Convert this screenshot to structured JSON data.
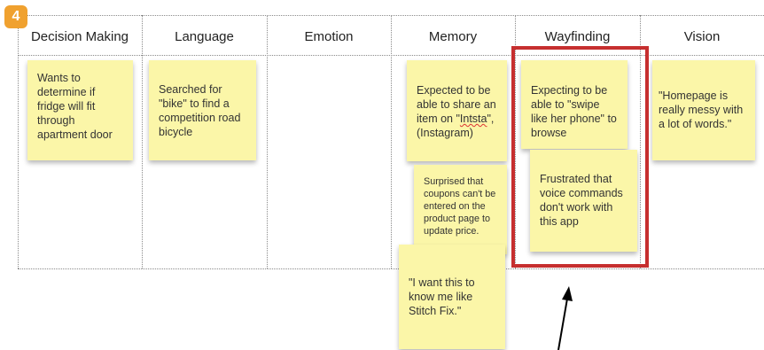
{
  "step_badge": "4",
  "columns": [
    "Decision Making",
    "Language",
    "Emotion",
    "Memory",
    "Wayfinding",
    "Vision"
  ],
  "notes": {
    "decision_making": "Wants to determine if fridge will fit through apartment door",
    "language": "Searched for \"bike\" to find a competition road bicycle",
    "memory_1_before": "Expected to be able to share an item on \"",
    "memory_1_typo": "Intsta",
    "memory_1_after": "\", (Instagram)",
    "memory_2": "Surprised that coupons can't be entered on the product page to update price.",
    "memory_3": "\"I want this to know me like Stitch Fix.\"",
    "wayfinding_1": "Expecting to be able to \"swipe like her phone\" to browse",
    "wayfinding_2": "Frustrated that voice commands don't work with this app",
    "vision": "\"Homepage is really messy with a lot of words.\""
  },
  "colors": {
    "sticky_note": "#fbf6a8",
    "highlight_border": "#c62f2f",
    "badge": "#f0a12f"
  },
  "icons": [
    "pointer-arrow-icon"
  ]
}
